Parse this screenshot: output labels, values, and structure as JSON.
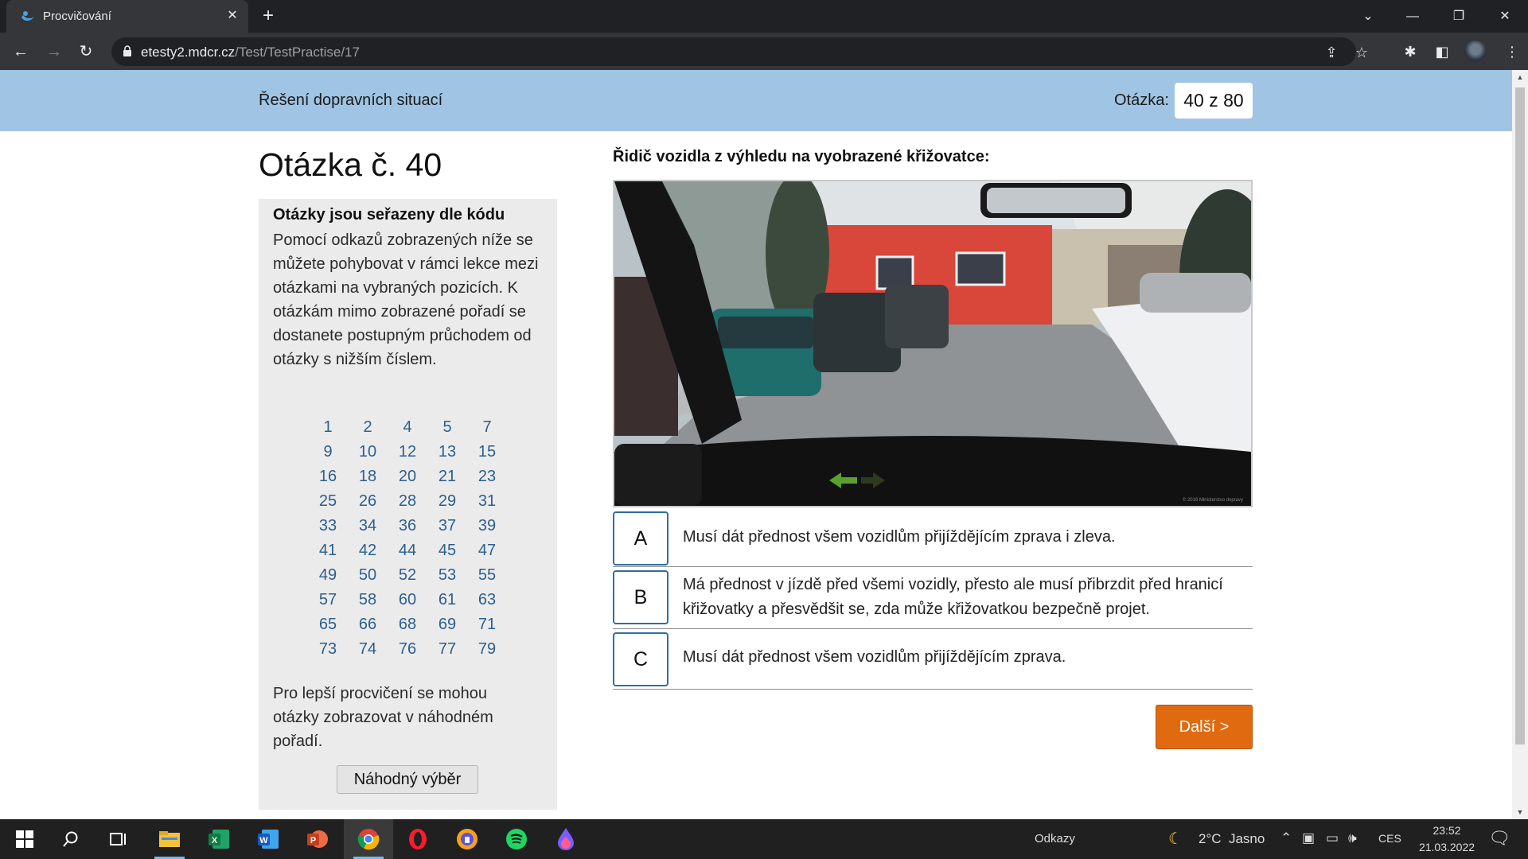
{
  "browser": {
    "tab_title": "Procvičování",
    "url_host": "etesty2.mdcr.cz",
    "url_path": "/Test/TestPractise/17"
  },
  "header": {
    "section_title": "Řešení dopravních situací",
    "counter_label": "Otázka:",
    "counter_value": "40 z 80"
  },
  "question": {
    "heading": "Otázka č. 40",
    "prompt": "Řidič vozidla z výhledu na vyobrazené křižovatce:",
    "answers": [
      {
        "letter": "A",
        "text": "Musí dát přednost všem vozidlům přijíždějícím zprava i zleva."
      },
      {
        "letter": "B",
        "text": "Má přednost v jízdě před všemi vozidly, přesto ale musí přibrzdit před hranicí křižovatky a přesvědšit se, zda může křižovatkou bezpečně projet."
      },
      {
        "letter": "C",
        "text": "Musí dát přednost všem vozidlům přijíždějícím zprava."
      }
    ],
    "next_label": "Další >",
    "image_caption": "© 2016 Ministerstvo dopravy"
  },
  "sidebar": {
    "title": "Otázky jsou seřazeny dle kódu",
    "text": "Pomocí odkazů zobrazených níže se můžete pohybovat v rámci lekce mezi otázkami na vybraných pozicích. K otázkám mimo zobrazené pořadí se dostanete postupným průchodem od otázky s nižším číslem.",
    "numbers": [
      [
        "1",
        "2",
        "4",
        "5",
        "7"
      ],
      [
        "9",
        "10",
        "12",
        "13",
        "15"
      ],
      [
        "16",
        "18",
        "20",
        "21",
        "23"
      ],
      [
        "25",
        "26",
        "28",
        "29",
        "31"
      ],
      [
        "33",
        "34",
        "36",
        "37",
        "39"
      ],
      [
        "41",
        "42",
        "44",
        "45",
        "47"
      ],
      [
        "49",
        "50",
        "52",
        "53",
        "55"
      ],
      [
        "57",
        "58",
        "60",
        "61",
        "63"
      ],
      [
        "65",
        "66",
        "68",
        "69",
        "71"
      ],
      [
        "73",
        "74",
        "76",
        "77",
        "79"
      ]
    ],
    "random_text": "Pro lepší procvičení se mohou otázky zobrazovat v náhodném pořadí.",
    "random_button": "Náhodný výběr"
  },
  "taskbar": {
    "links_label": "Odkazy",
    "weather": "2°C  Jasno",
    "language": "CES",
    "time": "23:52",
    "date": "21.03.2022",
    "apps": [
      "start-icon",
      "search-icon",
      "task-view-icon",
      "file-explorer-icon",
      "excel-icon",
      "word-icon",
      "powerpoint-icon",
      "chrome-icon",
      "opera-icon",
      "brave-icon",
      "spotify-icon",
      "paint-drop-icon"
    ]
  },
  "colors": {
    "header_bg": "#9fc4e4",
    "link": "#2b5f8e",
    "answer_border": "#2f6ea3",
    "next_button": "#e06a10"
  }
}
